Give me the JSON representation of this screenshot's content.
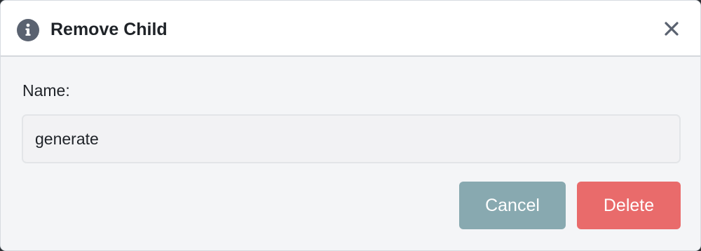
{
  "dialog": {
    "title": "Remove Child",
    "title_icon": "info-icon",
    "close_icon": "close-icon"
  },
  "form": {
    "name_label": "Name:",
    "name_value": "generate"
  },
  "actions": {
    "cancel_label": "Cancel",
    "delete_label": "Delete"
  },
  "colors": {
    "cancel_button": "#88a9b0",
    "delete_button": "#e96b6b",
    "info_icon": "#5a6270",
    "close_icon": "#5a6270"
  }
}
